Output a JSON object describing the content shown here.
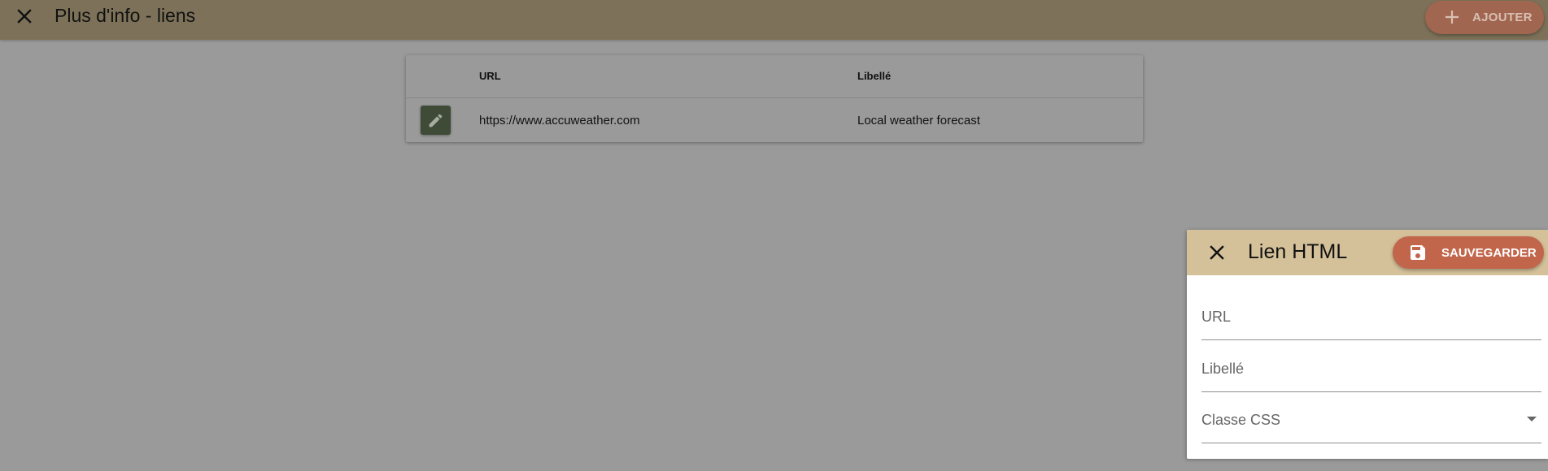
{
  "topbar": {
    "title": "Plus d'info - liens",
    "close_icon": "close-icon",
    "add_label": "AJOUTER",
    "add_icon": "plus-icon"
  },
  "table": {
    "columns": {
      "action": "",
      "url": "URL",
      "label": "Libellé"
    },
    "rows": [
      {
        "edit_icon": "pencil-icon",
        "url": "https://www.accuweather.com",
        "label": "Local weather forecast"
      }
    ]
  },
  "panel": {
    "title": "Lien HTML",
    "close_icon": "close-icon",
    "save_label": "SAUVEGARDER",
    "save_icon": "floppy-disk-icon",
    "fields": {
      "url_placeholder": "URL",
      "label_placeholder": "Libellé",
      "css_placeholder": "Classe CSS"
    }
  },
  "colors": {
    "topbar": "#7d7259",
    "panel_header": "#d4c19a",
    "save_button": "#c2664b",
    "edit_button": "#3f4a37",
    "overlay": "#9a9a9a"
  }
}
